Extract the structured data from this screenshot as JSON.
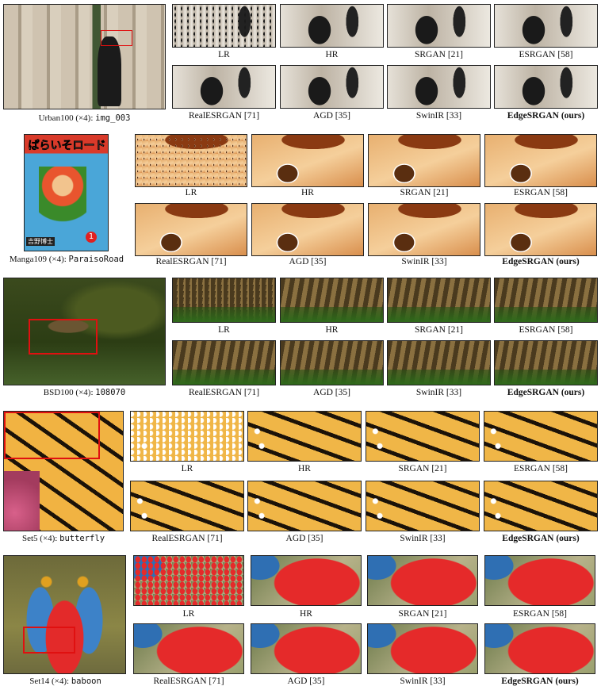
{
  "labels": {
    "lr": "LR",
    "hr": "HR",
    "srgan": "SRGAN [21]",
    "esrgan": "ESRGAN [58]",
    "realesrgan": "RealESRGAN [71]",
    "agd": "AGD [35]",
    "swinir": "SwinIR [33]",
    "edgesrgan": "EdgeSRGAN (ours)"
  },
  "rows": [
    {
      "dataset": "Urban100 (×4): ",
      "image": "img_003"
    },
    {
      "dataset": "Manga109 (×4): ",
      "image": "ParaisoRoad"
    },
    {
      "dataset": "BSD100 (×4): ",
      "image": "108070"
    },
    {
      "dataset": "Set5 (×4): ",
      "image": "butterfly"
    },
    {
      "dataset": "Set14 (×4): ",
      "image": "baboon"
    }
  ],
  "manga_cover": {
    "title": "ぱらいそロード",
    "author": "吉野博士",
    "volume": "1"
  }
}
